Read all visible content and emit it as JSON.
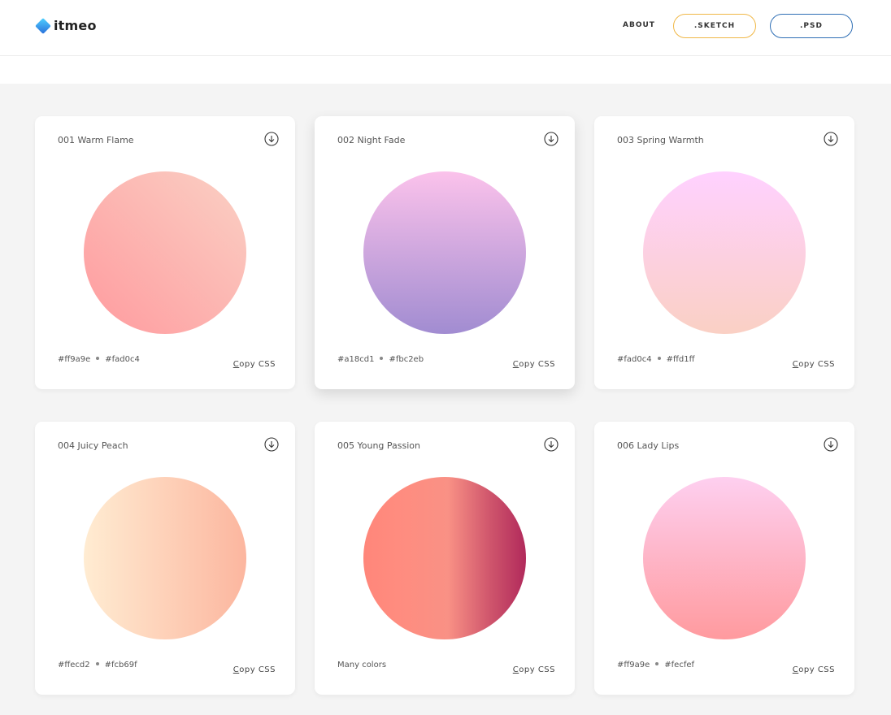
{
  "header": {
    "logo_text": "itmeo",
    "nav_about": "ABOUT",
    "btn_sketch": ".SKETCH",
    "btn_psd": ".PSD"
  },
  "cards": [
    {
      "title": "001 Warm Flame",
      "color1": "#ff9a9e",
      "color2": "#fad0c4",
      "copy_first": "C",
      "copy_rest": "opy CSS",
      "gradient": "linear-gradient(45deg, #ff9a9e 0%, #fad0c4 99%, #fad0c4 100%)"
    },
    {
      "title": "002 Night Fade",
      "color1": "#a18cd1",
      "color2": "#fbc2eb",
      "copy_first": "C",
      "copy_rest": "opy CSS",
      "gradient": "linear-gradient(to top, #a18cd1 0%, #fbc2eb 100%)"
    },
    {
      "title": "003 Spring Warmth",
      "color1": "#fad0c4",
      "color2": "#ffd1ff",
      "copy_first": "C",
      "copy_rest": "opy CSS",
      "gradient": "linear-gradient(to top, #fad0c4 0%, #ffd1ff 100%)"
    },
    {
      "title": "004 Juicy Peach",
      "color1": "#ffecd2",
      "color2": "#fcb69f",
      "copy_first": "C",
      "copy_rest": "opy CSS",
      "gradient": "linear-gradient(to right, #ffecd2 0%, #fcb69f 100%)"
    },
    {
      "title": "005 Young Passion",
      "many_colors": "Many colors",
      "copy_first": "C",
      "copy_rest": "opy CSS",
      "gradient": "linear-gradient(to right, #ff8177 0%, #ff867a 0%, #ff8c7f 21%, #f99185 52%, #cf556c 78%, #b12a5b 100%)"
    },
    {
      "title": "006 Lady Lips",
      "color1": "#ff9a9e",
      "color2": "#fecfef",
      "copy_first": "C",
      "copy_rest": "opy CSS",
      "gradient": "linear-gradient(to top, #ff9a9e 0%, #fecfef 99%, #fecfef 100%)"
    }
  ]
}
